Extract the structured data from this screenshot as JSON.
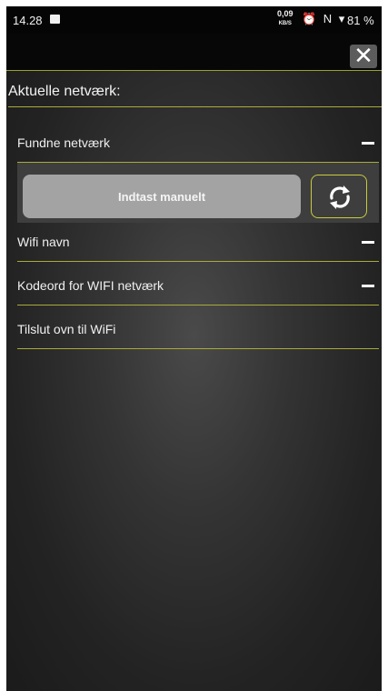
{
  "status_bar": {
    "time": "14.28",
    "speed_value": "0,09",
    "speed_unit": "KB/S",
    "indicators": "⏰ N ▾",
    "battery": "81 %"
  },
  "header": {
    "close_label": "✕"
  },
  "section": {
    "title": "Aktuelle netværk:"
  },
  "rows": {
    "found_networks": "Fundne netværk",
    "wifi_name": "Wifi navn",
    "wifi_password": "Kodeord for WIFI netværk",
    "connect": "Tilslut ovn til WiFi"
  },
  "manual": {
    "button_label": "Indtast manuelt"
  },
  "icons": {
    "close": "close-icon",
    "refresh": "refresh-icon",
    "collapse": "minus-icon"
  },
  "colors": {
    "accent": "#a8ab3a",
    "button_grey": "#a3a3a3"
  }
}
